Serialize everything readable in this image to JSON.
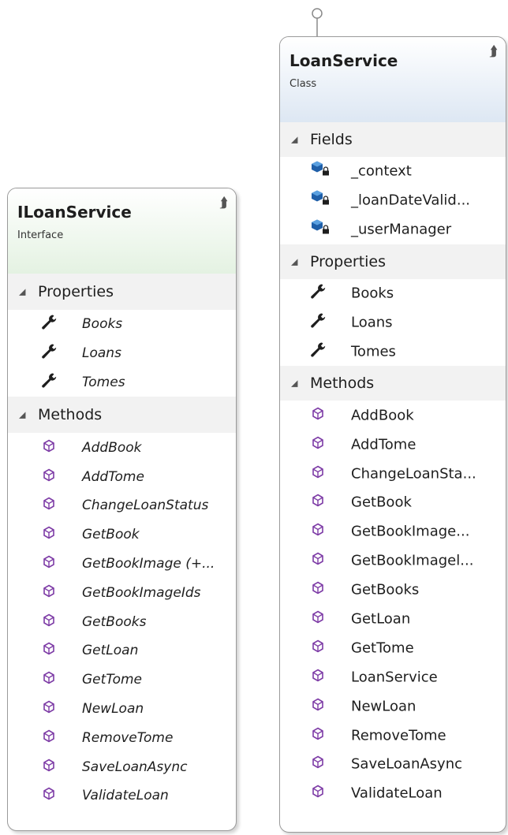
{
  "colors": {
    "header_gradient_left_top": "#eef7ee",
    "header_gradient_interface": "#e4f2e2",
    "header_gradient_class": "#dde7f3",
    "section_bg": "#f2f2f2",
    "method_icon": "#7d3ba6",
    "field_icon": "#1f5fa8",
    "wrench_icon": "#1e1e1e"
  },
  "interface": {
    "name": "ILoanService",
    "kind": "Interface",
    "sections": [
      {
        "label": "Properties",
        "icon": "wrench-icon",
        "items": [
          "Books",
          "Loans",
          "Tomes"
        ]
      },
      {
        "label": "Methods",
        "icon": "method-icon",
        "items": [
          "AddBook",
          "AddTome",
          "ChangeLoanStatus",
          "GetBook",
          "GetBookImage (+...",
          "GetBookImageIds",
          "GetBooks",
          "GetLoan",
          "GetTome",
          "NewLoan",
          "RemoveTome",
          "SaveLoanAsync",
          "ValidateLoan"
        ]
      }
    ]
  },
  "class": {
    "name": "LoanService",
    "kind": "Class",
    "sections": [
      {
        "label": "Fields",
        "icon": "private-field-icon",
        "items": [
          "_context",
          "_loanDateValid...",
          "_userManager"
        ]
      },
      {
        "label": "Properties",
        "icon": "wrench-icon",
        "items": [
          "Books",
          "Loans",
          "Tomes"
        ]
      },
      {
        "label": "Methods",
        "icon": "method-icon",
        "items": [
          "AddBook",
          "AddTome",
          "ChangeLoanSta...",
          "GetBook",
          "GetBookImage...",
          "GetBookImagel...",
          "GetBooks",
          "GetLoan",
          "GetTome",
          "LoanService",
          "NewLoan",
          "RemoveTome",
          "SaveLoanAsync",
          "ValidateLoan"
        ]
      }
    ]
  }
}
